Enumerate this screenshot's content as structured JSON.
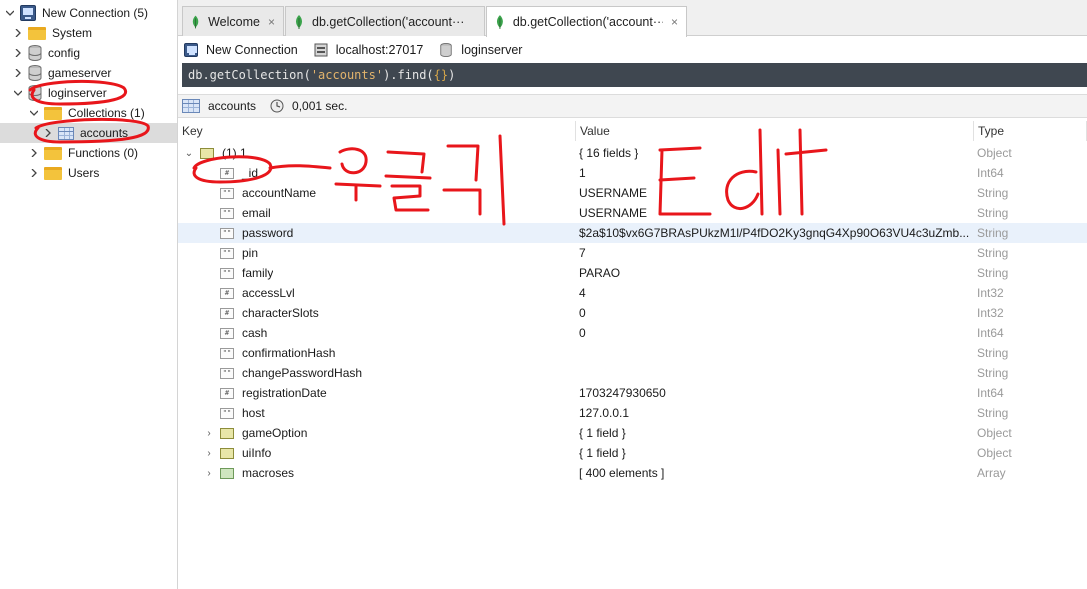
{
  "sidebar": {
    "root": {
      "label": "New Connection (5)",
      "icon": "server-icon"
    },
    "items": [
      {
        "label": "System",
        "icon": "folder-icon"
      },
      {
        "label": "config",
        "icon": "database-icon"
      },
      {
        "label": "gameserver",
        "icon": "database-icon"
      },
      {
        "label": "loginserver",
        "icon": "database-icon"
      },
      {
        "label": "Collections (1)",
        "icon": "folder-icon"
      },
      {
        "label": "accounts",
        "icon": "collection-table-icon"
      },
      {
        "label": "Functions (0)",
        "icon": "folder-icon"
      },
      {
        "label": "Users",
        "icon": "folder-icon"
      }
    ]
  },
  "tabs": [
    {
      "label": "Welcome",
      "icon": "mongodb-leaf-icon",
      "close": "×"
    },
    {
      "label": "db.getCollection('account···",
      "icon": "mongodb-leaf-icon",
      "close": "×"
    },
    {
      "label": "db.getCollection('account···",
      "icon": "mongodb-leaf-icon",
      "close": "×"
    }
  ],
  "connection": {
    "name": "New Connection",
    "host": "localhost:27017",
    "database": "loginserver"
  },
  "query": {
    "prefix": "db.getCollection(",
    "collection": "'accounts'",
    "suffix": ").find(",
    "args": "{}",
    "end": ")"
  },
  "result": {
    "collection": "accounts",
    "time": "0,001 sec."
  },
  "grid": {
    "headers": {
      "key": "Key",
      "value": "Value",
      "type": "Type"
    },
    "root": {
      "key": "(1) 1",
      "value": "{ 16 fields }",
      "type": "Object"
    },
    "fields": [
      {
        "key": "_id",
        "value": "1",
        "type": "Int64",
        "icon": "number-field-icon"
      },
      {
        "key": "accountName",
        "value": "USERNAME",
        "type": "String",
        "icon": "string-field-icon"
      },
      {
        "key": "email",
        "value": "USERNAME",
        "type": "String",
        "icon": "string-field-icon"
      },
      {
        "key": "password",
        "value": "$2a$10$vx6G7BRAsPUkzM1l/P4fDO2Ky3gnqG4Xp90O63VU4c3uZmb...",
        "type": "String",
        "icon": "string-field-icon"
      },
      {
        "key": "pin",
        "value": "7",
        "type": "String",
        "icon": "string-field-icon"
      },
      {
        "key": "family",
        "value": "PARAO",
        "type": "String",
        "icon": "string-field-icon"
      },
      {
        "key": "accessLvl",
        "value": "4",
        "type": "Int32",
        "icon": "number-field-icon"
      },
      {
        "key": "characterSlots",
        "value": "0",
        "type": "Int32",
        "icon": "number-field-icon"
      },
      {
        "key": "cash",
        "value": "0",
        "type": "Int64",
        "icon": "number-field-icon"
      },
      {
        "key": "confirmationHash",
        "value": "",
        "type": "String",
        "icon": "string-field-icon"
      },
      {
        "key": "changePasswordHash",
        "value": "",
        "type": "String",
        "icon": "string-field-icon"
      },
      {
        "key": "registrationDate",
        "value": "1703247930650",
        "type": "Int64",
        "icon": "number-field-icon"
      },
      {
        "key": "host",
        "value": "127.0.0.1",
        "type": "String",
        "icon": "string-field-icon"
      },
      {
        "key": "gameOption",
        "value": "{ 1 field }",
        "type": "Object",
        "icon": "object-field-icon"
      },
      {
        "key": "uiInfo",
        "value": "{ 1 field }",
        "type": "Object",
        "icon": "object-field-icon"
      },
      {
        "key": "macroses",
        "value": "[ 400 elements ]",
        "type": "Array",
        "icon": "array-field-icon"
      }
    ]
  },
  "annotation_color": "#e8161b"
}
